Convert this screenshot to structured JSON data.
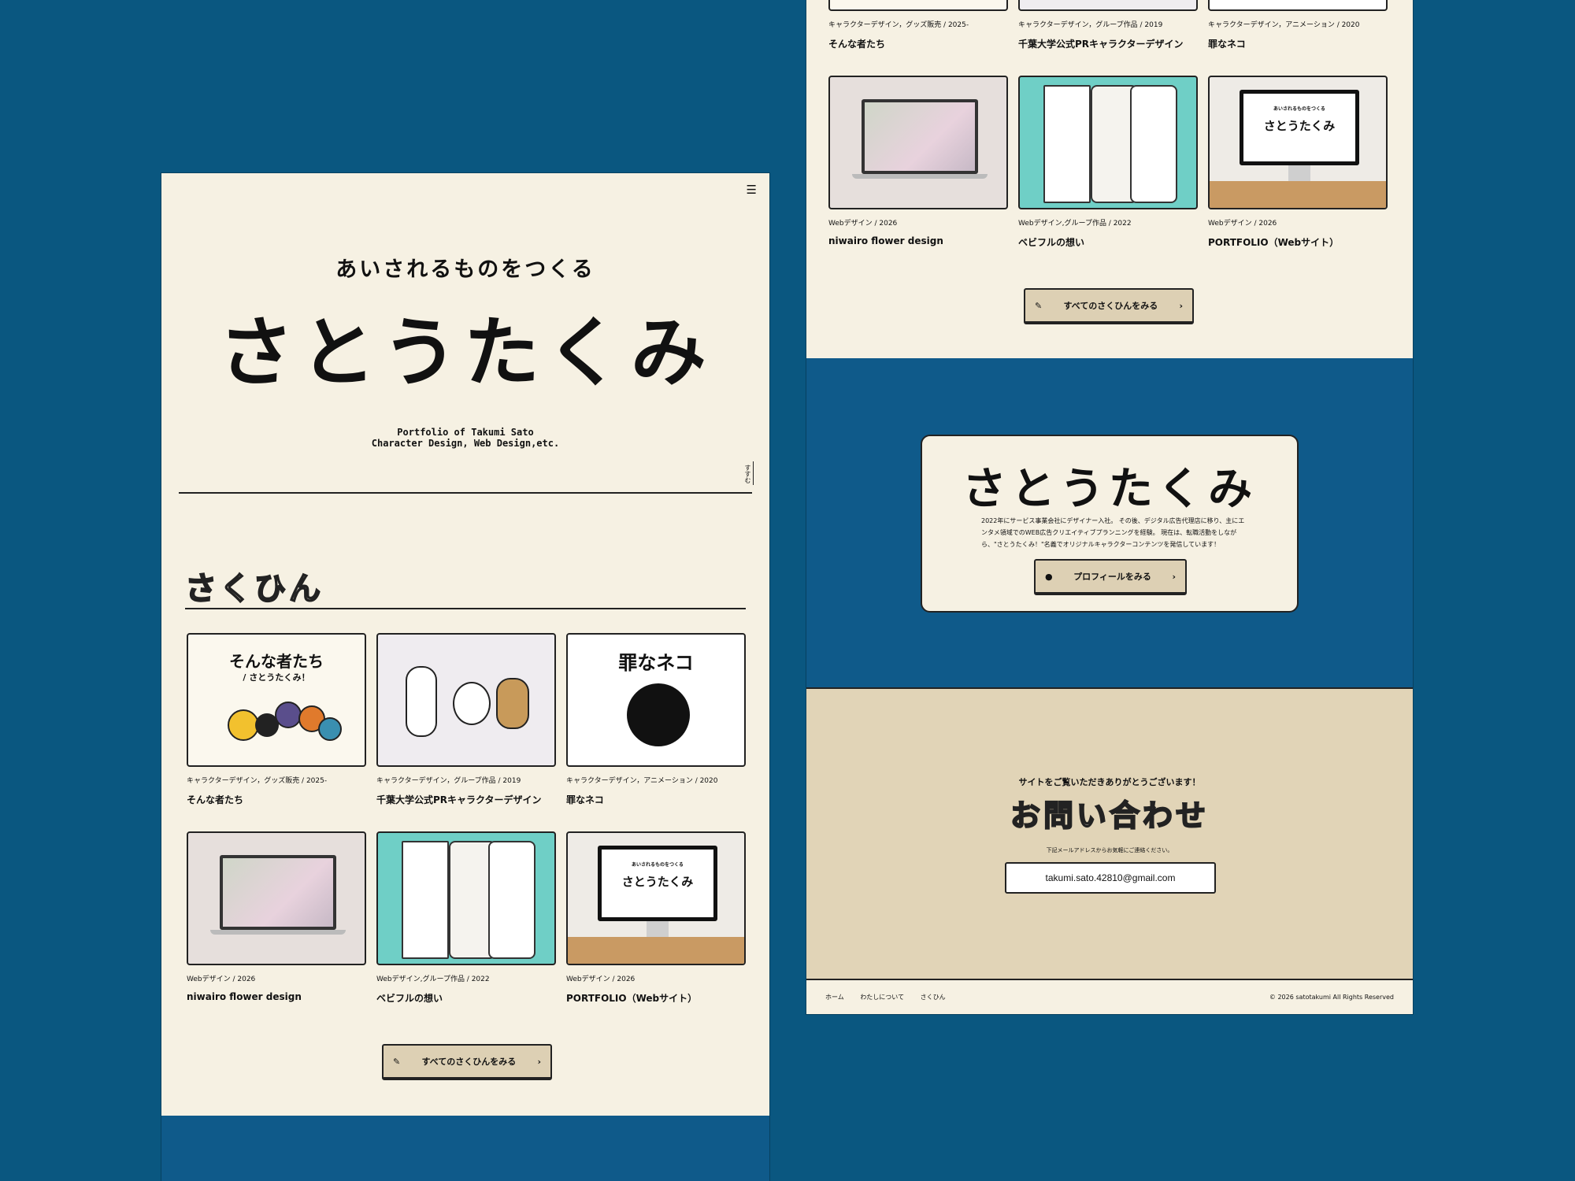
{
  "left": {
    "menu_icon": "hamburger-icon",
    "tagline": "あいされるものをつくる",
    "name": "さとうたくみ",
    "subtitle_line1": "Portfolio of Takumi Sato",
    "subtitle_line2": "Character Design, Web Design,etc.",
    "scroll_label": "すすむ",
    "section_title": "さくひん",
    "works": [
      {
        "thumb_text": "そんな者たち",
        "thumb_sub": "/ さとうたくみ！",
        "meta": "キャラクターデザイン，グッズ販売 / 2025-",
        "title": "そんな者たち"
      },
      {
        "thumb_text": "",
        "thumb_sub": "",
        "meta": "キャラクターデザイン，グループ作品 / 2019",
        "title": "千葉大学公式PRキャラクターデザイン"
      },
      {
        "thumb_text": "罪なネコ",
        "thumb_sub": "",
        "meta": "キャラクターデザイン，アニメーション / 2020",
        "title": "罪なネコ"
      },
      {
        "thumb_text": "",
        "thumb_sub": "",
        "meta": "Webデザイン / 2026",
        "title": "niwairo flower design"
      },
      {
        "thumb_text": "",
        "thumb_sub": "",
        "meta": "Webデザイン,グループ作品 / 2022",
        "title": "ベビフルの想い"
      },
      {
        "thumb_text": "さとうたくみ",
        "thumb_sub": "あいされるものをつくる",
        "meta": "Webデザイン / 2026",
        "title": "PORTFOLIO（Webサイト）"
      }
    ],
    "all_works_button": "すべてのさくひんをみる"
  },
  "right": {
    "works_top": [
      {
        "meta": "キャラクターデザイン，グッズ販売 / 2025-",
        "title": "そんな者たち"
      },
      {
        "meta": "キャラクターデザイン，グループ作品 / 2019",
        "title": "千葉大学公式PRキャラクターデザイン"
      },
      {
        "meta": "キャラクターデザイン，アニメーション / 2020",
        "title": "罪なネコ"
      }
    ],
    "works_bottom": [
      {
        "meta": "Webデザイン / 2026",
        "title": "niwairo flower design"
      },
      {
        "meta": "Webデザイン,グループ作品 / 2022",
        "title": "ベビフルの想い"
      },
      {
        "meta": "Webデザイン / 2026",
        "title": "PORTFOLIO（Webサイト）",
        "thumb_text": "さとうたくみ",
        "thumb_sub": "あいされるものをつくる"
      }
    ],
    "all_works_button": "すべてのさくひんをみる",
    "profile_name": "さとうたくみ",
    "profile_desc": "2022年にサービス事業会社にデザイナー入社。 その後、デジタル広告代理店に移り、主にエンタメ領域でのWEB広告クリエイティブプランニングを経験。 現在は、転職活動をしながら、\"さとうたくみ！\"名義でオリジナルキャラクターコンテンツを発信しています！",
    "profile_button": "プロフィールをみる",
    "thanks": "サイトをご覧いただきありがとうございます！",
    "contact_title": "お問い合わせ",
    "contact_note": "下記メールアドレスからお気軽にご連絡ください。",
    "email": "takumi.sato.42810@gmail.com",
    "footer_nav": [
      "ホーム",
      "わたしについて",
      "さくひん"
    ],
    "copyright": "© 2026 satotakumi All Rights Reserved"
  },
  "colors": {
    "background": "#0a5780",
    "cream": "#f6f1e3",
    "blue_section": "#0f5a8a",
    "beige": "#e1d4b7",
    "button": "#ddd0b4"
  }
}
